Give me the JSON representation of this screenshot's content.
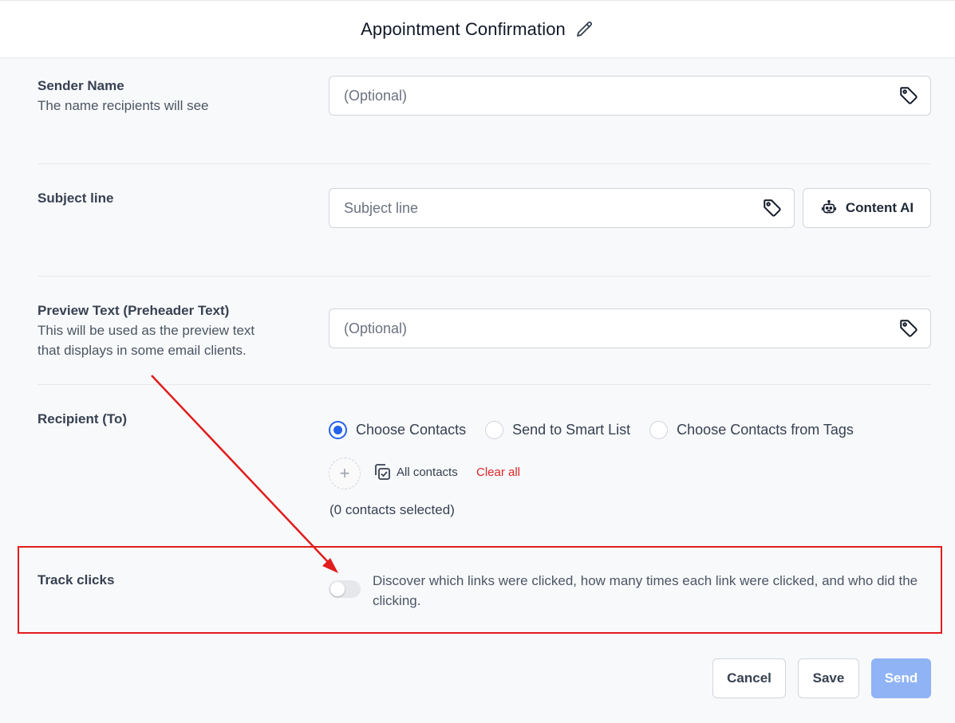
{
  "header": {
    "title": "Appointment Confirmation",
    "edit_icon": "pencil-icon"
  },
  "sender": {
    "label": "Sender Name",
    "description": "The name recipients will see",
    "placeholder": "(Optional)"
  },
  "subject": {
    "label": "Subject line",
    "placeholder": "Subject line",
    "content_ai_label": "Content AI"
  },
  "preview": {
    "label": "Preview Text (Preheader Text)",
    "description_line1": "This will be used as the preview text",
    "description_line2": "that displays in some email clients.",
    "placeholder": "(Optional)"
  },
  "recipient": {
    "label": "Recipient (To)",
    "options": [
      "Choose Contacts",
      "Send to Smart List",
      "Choose Contacts from Tags"
    ],
    "selected": "Choose Contacts",
    "all_contacts": "All contacts",
    "clear_all": "Clear all",
    "count_text": "(0 contacts selected)"
  },
  "track": {
    "label": "Track clicks",
    "enabled": false,
    "description": "Discover which links were clicked, how many times each link were clicked, and who did the clicking."
  },
  "footer": {
    "cancel": "Cancel",
    "save": "Save",
    "send": "Send"
  },
  "colors": {
    "primary": "#2563eb",
    "send_disabled": "#8fb3f5",
    "highlight": "#e11d1d",
    "danger": "#dc2626"
  }
}
